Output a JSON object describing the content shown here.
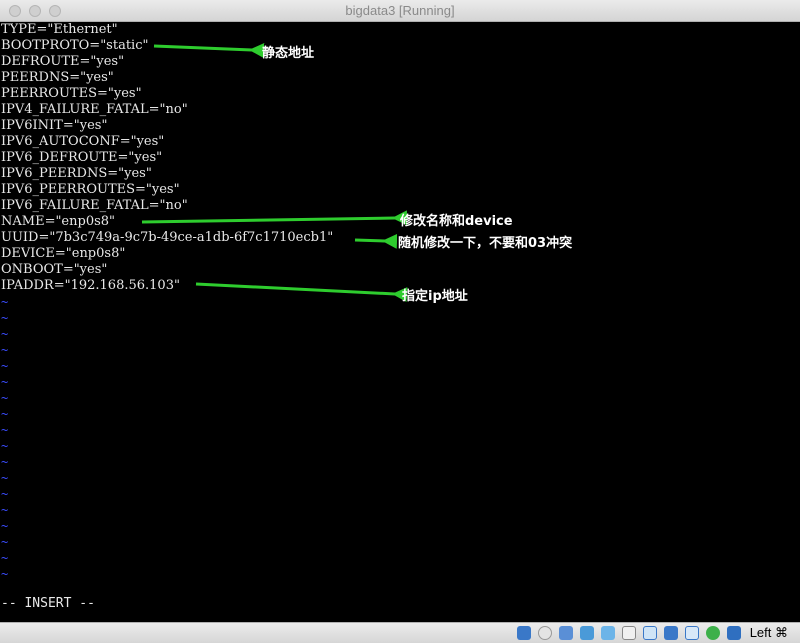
{
  "window": {
    "title": "bigdata3 [Running]"
  },
  "terminal": {
    "lines": [
      "TYPE=\"Ethernet\"",
      "BOOTPROTO=\"static\"",
      "DEFROUTE=\"yes\"",
      "PEERDNS=\"yes\"",
      "PEERROUTES=\"yes\"",
      "IPV4_FAILURE_FATAL=\"no\"",
      "IPV6INIT=\"yes\"",
      "IPV6_AUTOCONF=\"yes\"",
      "IPV6_DEFROUTE=\"yes\"",
      "IPV6_PEERDNS=\"yes\"",
      "IPV6_PEERROUTES=\"yes\"",
      "IPV6_FAILURE_FATAL=\"no\"",
      "NAME=\"enp0s8\"",
      "UUID=\"7b3c749a-9c7b-49ce-a1db-6f7c1710ecb1\"",
      "DEVICE=\"enp0s8\"",
      "ONBOOT=\"yes\"",
      "IPADDR=\"192.168.56.103\""
    ],
    "tilde": "~",
    "mode": "-- INSERT --"
  },
  "annotations": {
    "static": "静态地址",
    "name_device": "修改名称和device",
    "uuid": "随机修改一下，不要和03冲突",
    "ipaddr": "指定ip地址"
  },
  "statusbar": {
    "host_key": "Left ⌘",
    "icons": [
      "optical-disk-icon",
      "audio-icon",
      "usb-icon",
      "network-icon",
      "shared-folder-icon",
      "display-icon",
      "screen-capture-icon",
      "recording-icon",
      "virtualization-icon",
      "mouse-integration-icon",
      "download-icon"
    ]
  },
  "colors": {
    "arrow": "#2ecc2e",
    "tilde": "#3a4cff",
    "terminal_bg": "#000000"
  }
}
